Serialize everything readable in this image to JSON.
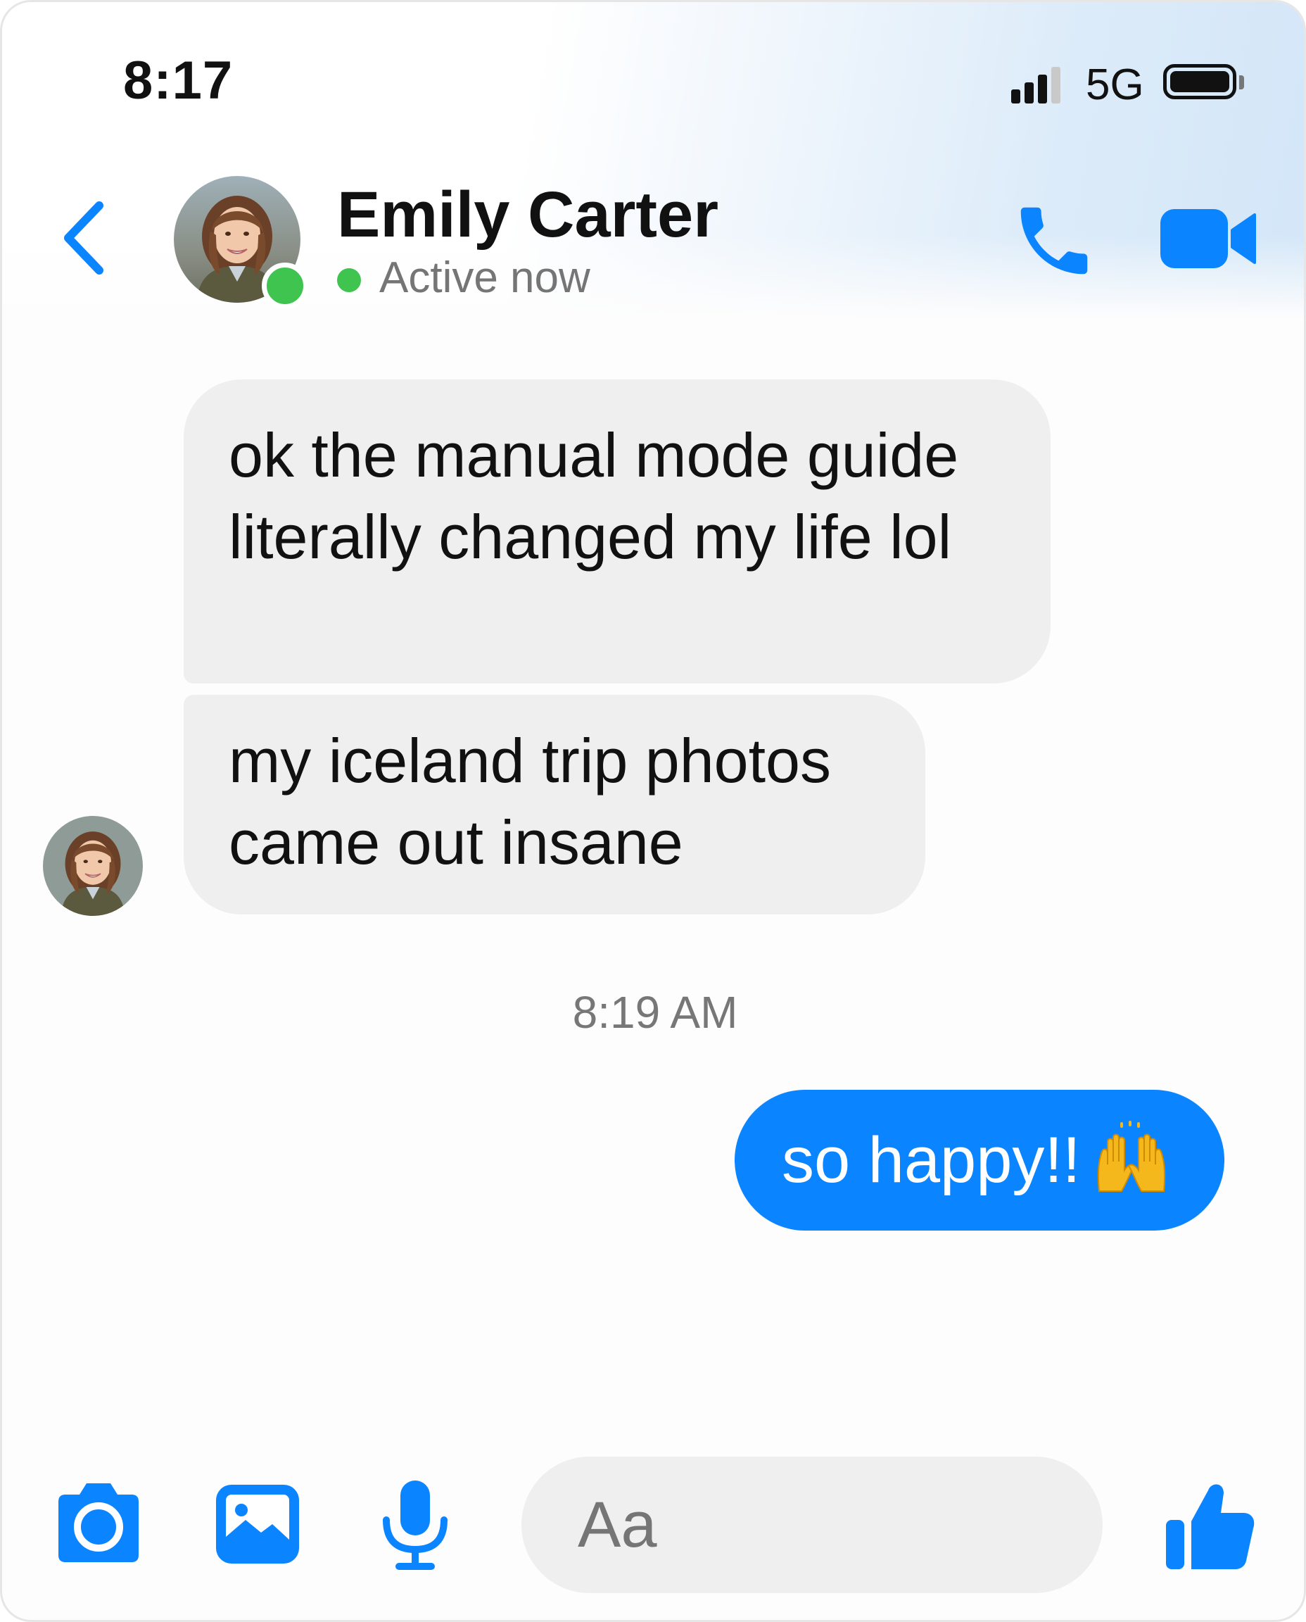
{
  "status_bar": {
    "time": "8:17",
    "network": "5G"
  },
  "header": {
    "contact_name": "Emily Carter",
    "presence": "Active now"
  },
  "messages": [
    {
      "direction": "incoming",
      "text_lines": [
        "ok the manual mode guide",
        "literally changed my life lol"
      ]
    },
    {
      "direction": "incoming",
      "text_lines": [
        "my iceland trip photos",
        "came out insane"
      ]
    },
    {
      "direction": "outgoing",
      "text": "so happy!!",
      "emoji": "raising-hands"
    }
  ],
  "timestamp": "8:19 AM",
  "composer": {
    "placeholder": "Aa"
  },
  "colors": {
    "accent": "#0a84ff",
    "online": "#3ec44f",
    "incoming_bubble": "#efefef"
  },
  "icons": [
    "back-chevron-icon",
    "phone-icon",
    "video-camera-icon",
    "camera-icon",
    "image-icon",
    "microphone-icon",
    "thumbs-up-icon"
  ]
}
